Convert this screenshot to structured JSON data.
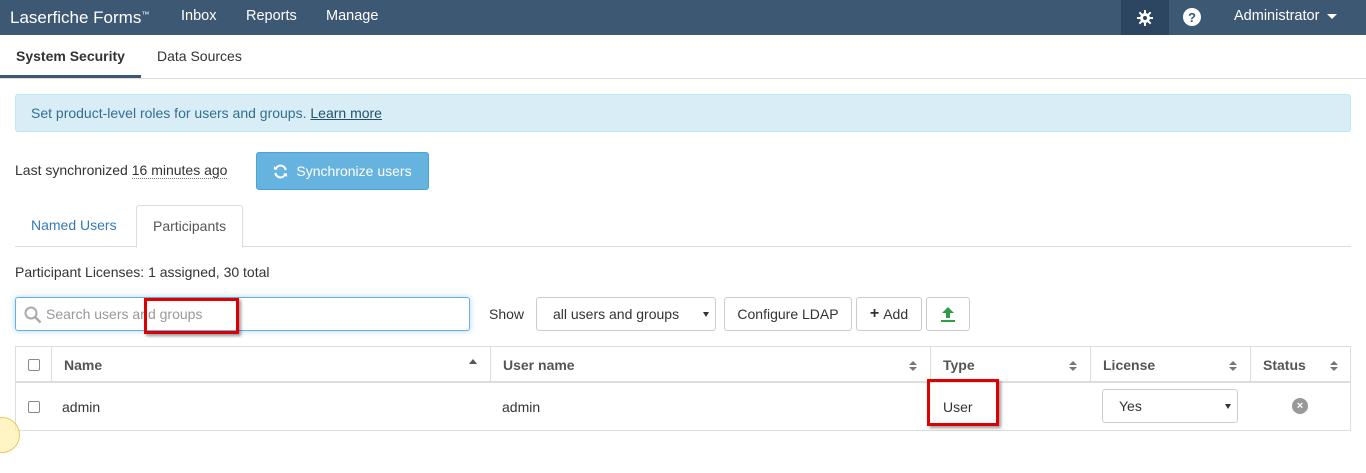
{
  "brand": {
    "name": "Laserfiche Forms",
    "tm": "™"
  },
  "nav": {
    "inbox": "Inbox",
    "reports": "Reports",
    "manage": "Manage",
    "help": "?",
    "user": "Administrator"
  },
  "subnav": {
    "system_security": "System Security",
    "data_sources": "Data Sources"
  },
  "alert": {
    "text": "Set product-level roles for users and groups. ",
    "link": "Learn more"
  },
  "sync": {
    "prefix": "Last synchronized ",
    "time": "16 minutes ago",
    "button": "Synchronize users"
  },
  "tabs": {
    "named_users": "Named Users",
    "participants": "Participants"
  },
  "licenses": "Participant Licenses: 1 assigned, 30 total",
  "search": {
    "placeholder": "Search users and groups",
    "value": ""
  },
  "show": {
    "label": "Show",
    "selected": "all users and groups"
  },
  "buttons": {
    "configure_ldap": "Configure LDAP",
    "add": "Add",
    "add_symbol": "+"
  },
  "table": {
    "headers": {
      "name": "Name",
      "username": "User name",
      "type": "Type",
      "license": "License",
      "status": "Status"
    },
    "rows": [
      {
        "name": "admin",
        "username": "admin",
        "type": "User",
        "license": "Yes"
      }
    ]
  },
  "colors": {
    "nav_bg": "#3d5873",
    "alert_bg": "#d9edf7",
    "sync_btn": "#67b3e0",
    "highlight": "#dd0000"
  }
}
